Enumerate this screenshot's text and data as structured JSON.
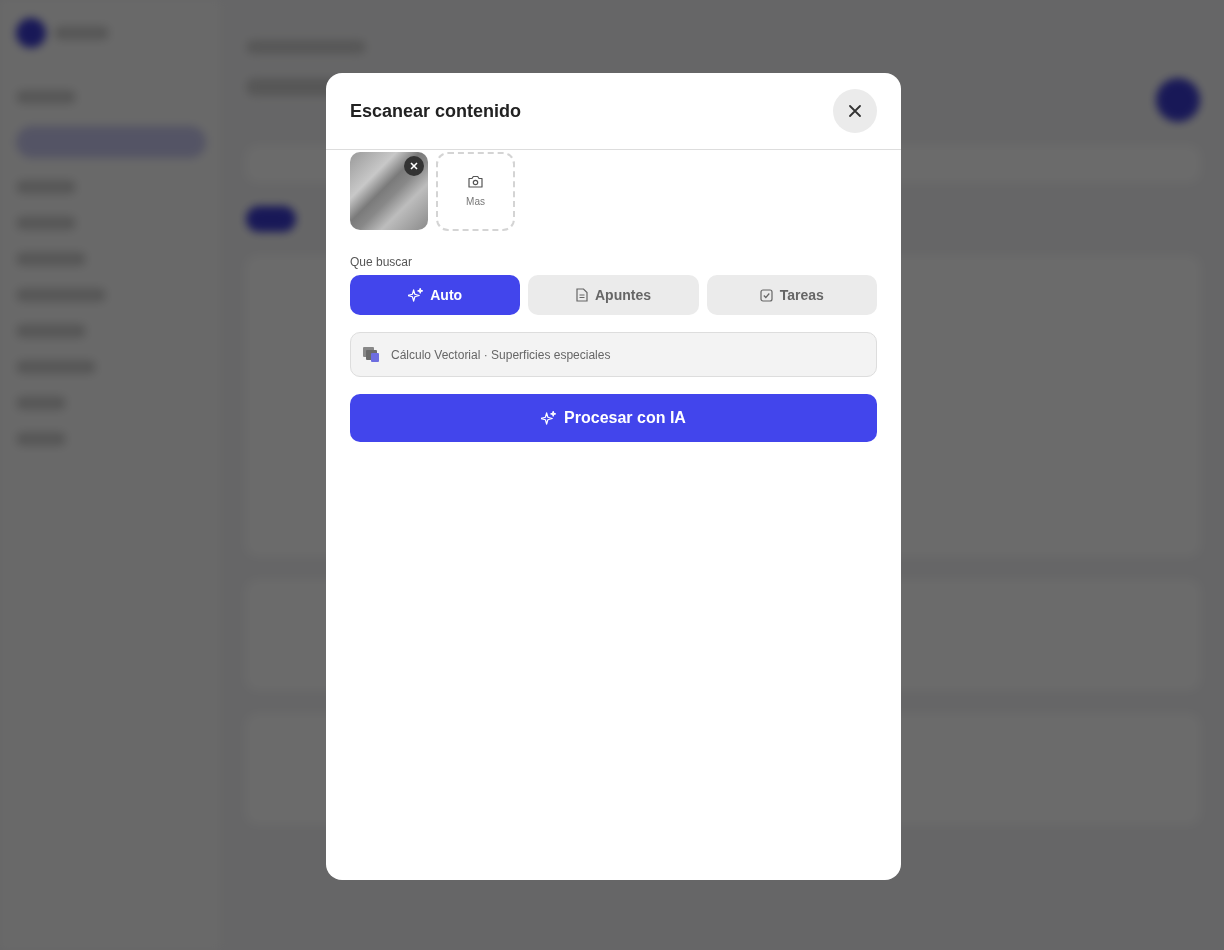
{
  "modal": {
    "title": "Escanear contenido",
    "photos": [
      {
        "kind": "scan"
      }
    ],
    "add_photo": {
      "label": "Mas"
    },
    "search_label": "Que buscar",
    "modes": [
      {
        "label": "Auto",
        "kind": "auto",
        "selected": true
      },
      {
        "label": "Apuntes",
        "kind": "notes",
        "selected": false
      },
      {
        "label": "Tareas",
        "kind": "tasks",
        "selected": false
      }
    ],
    "context": {
      "value": "Cálculo Vectorial · Superficies especiales"
    },
    "submit": {
      "label": "Procesar con IA"
    }
  }
}
